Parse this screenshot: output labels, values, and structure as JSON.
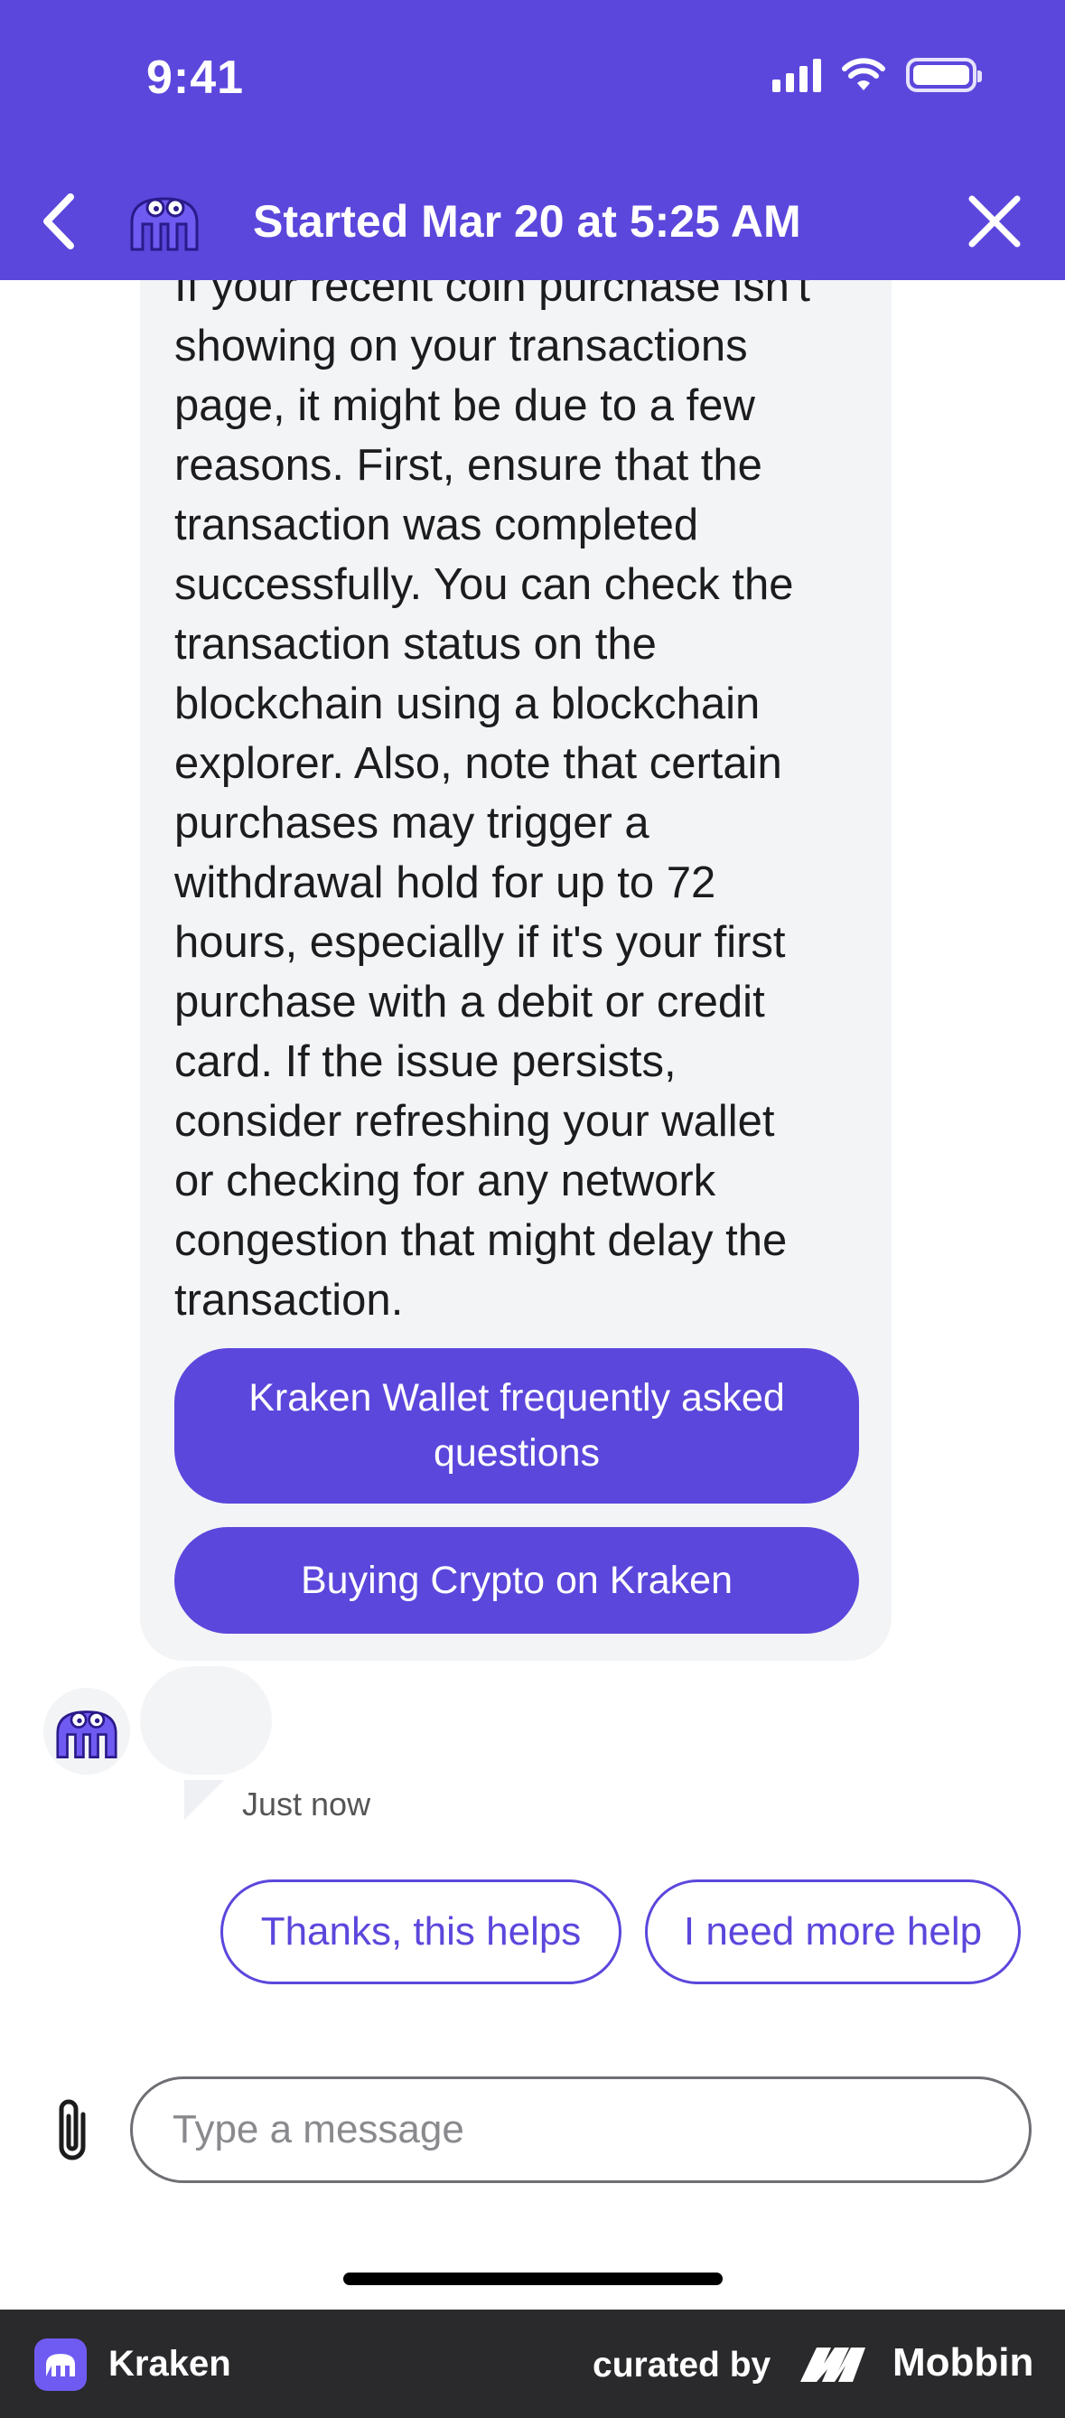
{
  "status_bar": {
    "time": "9:41"
  },
  "header": {
    "title": "Started Mar 20 at 5:25 AM"
  },
  "message": {
    "text": "If your recent coin purchase isn't\nshowing on your transactions\npage, it might be due to a few\nreasons. First, ensure that the\ntransaction was completed\nsuccessfully. You can check the\ntransaction status on the\nblockchain using a blockchain\nexplorer. Also, note that certain\npurchases may trigger a\nwithdrawal hold for up to 72\nhours, especially if it's your first\npurchase with a debit or credit\ncard. If the issue persists,\nconsider refreshing your wallet\nor checking for any network\ncongestion that might delay the\ntransaction.",
    "links": [
      {
        "label": "Kraken Wallet frequently asked questions"
      },
      {
        "label": "Buying Crypto on Kraken"
      }
    ]
  },
  "typing": {
    "timestamp": "Just now"
  },
  "quick_replies": [
    {
      "label": "Thanks, this helps"
    },
    {
      "label": "I need more help"
    }
  ],
  "composer": {
    "placeholder": "Type a message"
  },
  "footer": {
    "app_name": "Kraken",
    "curated_by": "curated by",
    "brand": "Mobbin"
  },
  "colors": {
    "accent": "#5b47dc",
    "bubble": "#f3f4f6",
    "footer": "#2a2a2c"
  }
}
